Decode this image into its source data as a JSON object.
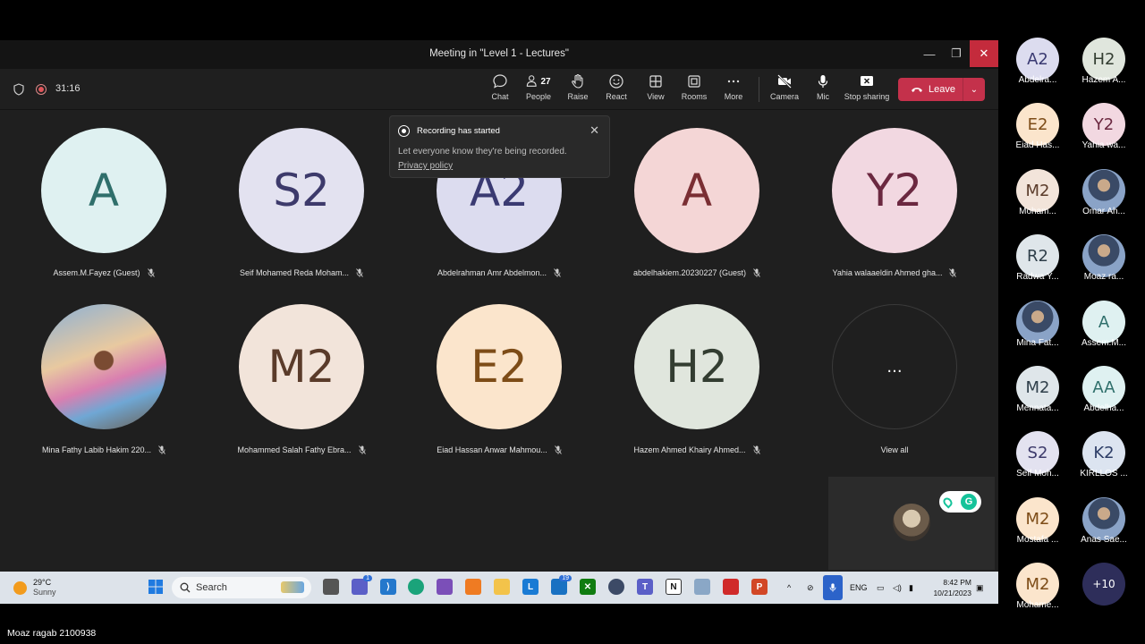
{
  "window": {
    "title": "Meeting in \"Level 1 - Lectures\"",
    "timer": "31:16"
  },
  "toolbar": {
    "buttons": [
      {
        "label": "Chat",
        "icon": "chat-icon"
      },
      {
        "label": "People",
        "icon": "people-icon",
        "count": "27"
      },
      {
        "label": "Raise",
        "icon": "raise-hand-icon"
      },
      {
        "label": "React",
        "icon": "react-icon"
      },
      {
        "label": "View",
        "icon": "view-icon"
      },
      {
        "label": "Rooms",
        "icon": "rooms-icon"
      },
      {
        "label": "More",
        "icon": "more-icon"
      },
      {
        "label": "Camera",
        "icon": "camera-off-icon"
      },
      {
        "label": "Mic",
        "icon": "mic-icon"
      },
      {
        "label": "Stop sharing",
        "icon": "stop-sharing-icon"
      }
    ],
    "leave_label": "Leave"
  },
  "toast": {
    "title": "Recording has started",
    "body": "Let everyone know they're being recorded.",
    "link": "Privacy policy"
  },
  "participants": [
    {
      "initials": "A",
      "name": "Assem.M.Fayez (Guest)",
      "bg": "#dff1f1",
      "fg": "#2f6f6b"
    },
    {
      "initials": "S2",
      "name": "Seif Mohamed Reda Moham...",
      "bg": "#e3e2f0",
      "fg": "#3d3a6b"
    },
    {
      "initials": "A2",
      "name": "Abdelrahman Amr Abdelmon...",
      "bg": "#dcdcef",
      "fg": "#3a3a72"
    },
    {
      "initials": "A",
      "name": "abdelhakiem.20230227 (Guest)",
      "bg": "#f4d6d6",
      "fg": "#7a2e33"
    },
    {
      "initials": "Y2",
      "name": "Yahia walaaeldin Ahmed gha...",
      "bg": "#f2d8e1",
      "fg": "#6b2840"
    },
    {
      "initials": "",
      "name": "Mina Fathy Labib Hakim 220...",
      "bg": "photo",
      "fg": ""
    },
    {
      "initials": "M2",
      "name": "Mohammed Salah Fathy Ebra...",
      "bg": "#f2e4da",
      "fg": "#5a3b2a"
    },
    {
      "initials": "E2",
      "name": "Eiad Hassan Anwar Mahmou...",
      "bg": "#fbe5cc",
      "fg": "#7d4c17"
    },
    {
      "initials": "H2",
      "name": "Hazem Ahmed Khairy Ahmed...",
      "bg": "#e0e6dd",
      "fg": "#333d31"
    }
  ],
  "view_all": {
    "label": "View all",
    "glyph": "..."
  },
  "taskbar": {
    "weather_temp": "29°C",
    "weather_desc": "Sunny",
    "search_placeholder": "Search",
    "teams_badge": "1",
    "mail_badge": "19",
    "lang": "ENG",
    "time": "8:42 PM",
    "date": "10/21/2023"
  },
  "sidebar": [
    {
      "initials": "A2",
      "name": "Abdelra...",
      "bg": "#dcdcef",
      "fg": "#3a3a72"
    },
    {
      "initials": "H2",
      "name": "Hazem A...",
      "bg": "#e0e6dd",
      "fg": "#333d31"
    },
    {
      "initials": "E2",
      "name": "Eiad Has...",
      "bg": "#fbe5cc",
      "fg": "#7d4c17"
    },
    {
      "initials": "Y2",
      "name": "Yahia wa...",
      "bg": "#f2d8e1",
      "fg": "#6b2840"
    },
    {
      "initials": "M2",
      "name": "Moham...",
      "bg": "#f2e4da",
      "fg": "#5a3b2a"
    },
    {
      "initials": "",
      "name": "Omar Ah...",
      "bg": "photo",
      "fg": ""
    },
    {
      "initials": "R2",
      "name": "Radwa Y...",
      "bg": "#dfe6ea",
      "fg": "#2f3f4a"
    },
    {
      "initials": "",
      "name": "Moaz ra...",
      "bg": "photo",
      "fg": ""
    },
    {
      "initials": "",
      "name": "Mina Fat...",
      "bg": "photo",
      "fg": ""
    },
    {
      "initials": "A",
      "name": "Assem.M...",
      "bg": "#dff1f1",
      "fg": "#2f6f6b"
    },
    {
      "initials": "M2",
      "name": "Mennata...",
      "bg": "#dfe6ea",
      "fg": "#2f3f4a"
    },
    {
      "initials": "AA",
      "name": "Abdelha...",
      "bg": "#dff1f1",
      "fg": "#2f6f6b"
    },
    {
      "initials": "S2",
      "name": "Seif Moh...",
      "bg": "#e3e2f0",
      "fg": "#3d3a6b"
    },
    {
      "initials": "K2",
      "name": "KIRLLOS ...",
      "bg": "#dce4f0",
      "fg": "#2d3d66"
    },
    {
      "initials": "M2",
      "name": "Mostafa ...",
      "bg": "#fbe5cc",
      "fg": "#7d4c17"
    },
    {
      "initials": "",
      "name": "Anas Sae...",
      "bg": "photo",
      "fg": ""
    },
    {
      "initials": "M2",
      "name": "Mohame...",
      "bg": "#fbe5cc",
      "fg": "#7d4c17"
    },
    {
      "initials": "+10",
      "name": "",
      "bg": "#2e2e5a",
      "fg": "#ffffff"
    }
  ],
  "footer_name": "Moaz ragab 2100938"
}
